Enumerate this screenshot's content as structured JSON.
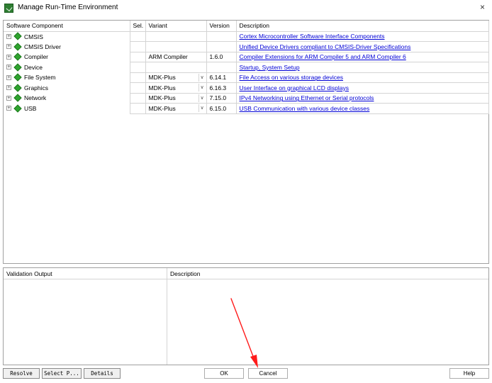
{
  "window": {
    "title": "Manage Run-Time Environment",
    "close": "×"
  },
  "table": {
    "headers": [
      "Software Component",
      "Sel.",
      "Variant",
      "Version",
      "Description"
    ],
    "rows": [
      {
        "component": "CMSIS",
        "sel": "",
        "variant": "",
        "version": "",
        "description": "Cortex Microcontroller Software Interface Components"
      },
      {
        "component": "CMSIS Driver",
        "sel": "",
        "variant": "",
        "version": "",
        "description": "Unified Device Drivers compliant to CMSIS-Driver Specifications"
      },
      {
        "component": "Compiler",
        "sel": "",
        "variant": "ARM Compiler",
        "version": "1.6.0",
        "description": "Compiler Extensions for ARM Compiler 5 and ARM Compiler 6"
      },
      {
        "component": "Device",
        "sel": "",
        "variant": "",
        "version": "",
        "description": "Startup, System Setup"
      },
      {
        "component": "File System",
        "sel": "",
        "variant": "MDK-Plus",
        "version": "6.14.1",
        "description": "File Access on various storage devices"
      },
      {
        "component": "Graphics",
        "sel": "",
        "variant": "MDK-Plus",
        "version": "6.16.3",
        "description": "User Interface on graphical LCD displays"
      },
      {
        "component": "Network",
        "sel": "",
        "variant": "MDK-Plus",
        "version": "7.15.0",
        "description": "IPv4 Networking using Ethernet or Serial protocols"
      },
      {
        "component": "USB",
        "sel": "",
        "variant": "MDK-Plus",
        "version": "6.15.0",
        "description": "USB Communication with various device classes"
      }
    ]
  },
  "validation": {
    "col1": "Validation Output",
    "col2": "Description"
  },
  "buttons": {
    "resolve": "Resolve",
    "select_packs": "Select P...",
    "details": "Details",
    "ok": "OK",
    "cancel": "Cancel",
    "help": "Help"
  },
  "annotation": {
    "arrow_color": "#ff1a1a"
  }
}
